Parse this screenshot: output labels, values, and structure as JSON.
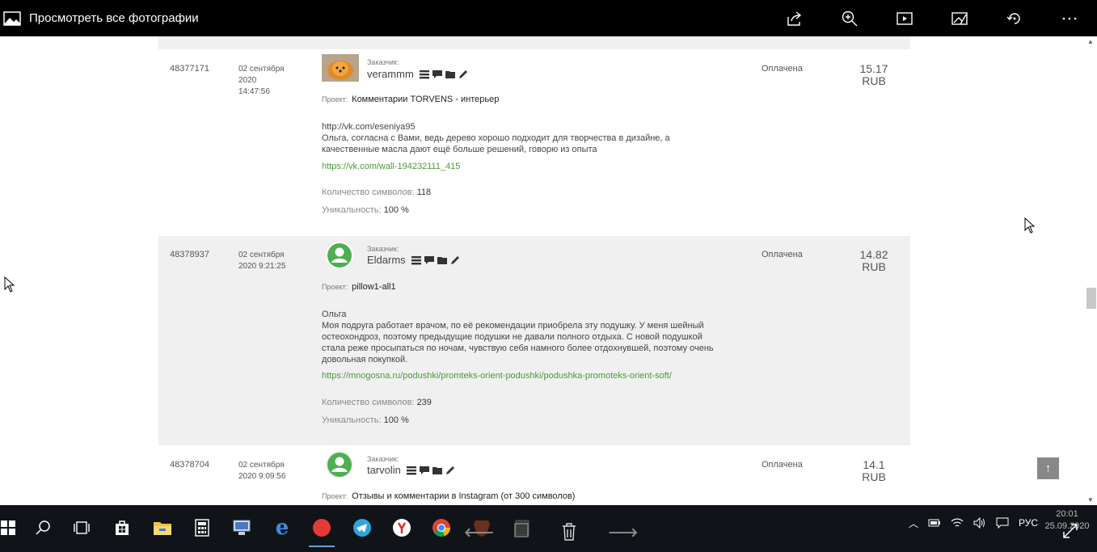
{
  "window": {
    "title": "Просмотреть все фотографии",
    "toolbar": [
      "share-icon",
      "zoom-icon",
      "slideshow-icon",
      "edit-icon",
      "rotate-icon",
      "more-icon"
    ]
  },
  "orders": [
    {
      "id": "48377171",
      "date_line1": "02 сентября",
      "date_line2": "2020",
      "date_line3": "14:47:56",
      "customer_label": "Заказчик:",
      "customer": "verammm",
      "avatar": "photo",
      "project_label": "Проект:",
      "project": "Комментарии TORVENS - интерьер",
      "text": "http://vk.com/eseniya95\nОльга, согласна с Вами, ведь дерево хорошо подходит для творчества в дизайне, а качественные масла дают ещё больше решений, говорю из опыта",
      "link": "https://vk.com/wall-194232111_415",
      "chars_label": "Количество символов:",
      "chars": "118",
      "uniq_label": "Уникальность:",
      "uniq": "100 %",
      "status": "Оплачена",
      "price": "15.17",
      "currency": "RUB"
    },
    {
      "id": "48378937",
      "date_line1": "02 сентября",
      "date_line2": "2020 9:21:25",
      "customer_label": "Заказчик:",
      "customer": "Eldarms",
      "avatar": "default",
      "project_label": "Проект:",
      "project": "pillow1-all1",
      "text": "Ольга\nМоя подруга работает врачом, по её рекомендации приобрела эту подушку. У меня шейный остеохондроз, поэтому предыдущие подушки не давали полного отдыха. С новой подушкой стала реже просыпаться по ночам, чувствую себя намного более отдохнувшей, поэтому очень довольная покупкой.",
      "link": "https://mnogosna.ru/podushki/promteks-orient-podushki/podushka-promoteks-orient-soft/",
      "chars_label": "Количество символов:",
      "chars": "239",
      "uniq_label": "Уникальность:",
      "uniq": "100 %",
      "status": "Оплачена",
      "price": "14.82",
      "currency": "RUB"
    },
    {
      "id": "48378704",
      "date_line1": "02 сентября",
      "date_line2": "2020 9:09:56",
      "customer_label": "Заказчик:",
      "customer": "tarvolin",
      "avatar": "default",
      "project_label": "Проект:",
      "project": "Отзывы и комментарии в Instagram (от 300 символов)",
      "status": "Оплачена",
      "price": "14.1",
      "currency": "RUB"
    }
  ],
  "scroll_top_label": "↑",
  "taskbar": {
    "apps": [
      "windows-start-icon",
      "search-icon",
      "task-view-icon",
      "store-icon",
      "file-explorer-icon",
      "calculator-icon",
      "network-app-icon",
      "edge-icon",
      "radio-app-icon",
      "telegram-icon",
      "yandex-browser-icon",
      "chrome-icon",
      "brave-icon",
      "photos-icon"
    ],
    "language": "РУС",
    "time": "20:01",
    "date": "25.09.2020"
  },
  "colors": {
    "link": "#4a9a39",
    "row_alt": "#f0f0f0",
    "taskbar": "#101418"
  }
}
